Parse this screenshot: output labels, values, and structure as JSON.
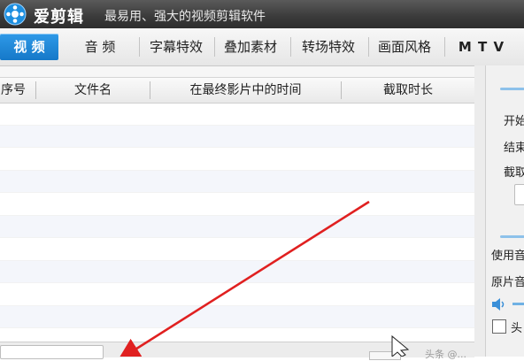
{
  "app": {
    "name": "爱剪辑",
    "slogan": "最易用、强大的视频剪辑软件"
  },
  "tabs": [
    {
      "label": "视 频",
      "active": true
    },
    {
      "label": "音 频",
      "active": false
    },
    {
      "label": "字幕特效",
      "active": false
    },
    {
      "label": "叠加素材",
      "active": false
    },
    {
      "label": "转场特效",
      "active": false
    },
    {
      "label": "画面风格",
      "active": false
    },
    {
      "label": "M T V",
      "active": false
    }
  ],
  "table": {
    "columns": [
      "序号",
      "文件名",
      "在最终影片中的时间",
      "截取时长"
    ],
    "rows": []
  },
  "right_panel": {
    "start_label": "开始",
    "end_label": "结束",
    "clip_label": "截取",
    "use_audio_label": "使用音",
    "original_audio_label": "原片音",
    "head_checkbox_label": "头"
  },
  "watermark": "头条 @...",
  "colors": {
    "accent": "#1e88d6",
    "arrow": "#e02020"
  },
  "icons": [
    "app-logo-icon",
    "speaker-icon",
    "cursor-icon"
  ]
}
